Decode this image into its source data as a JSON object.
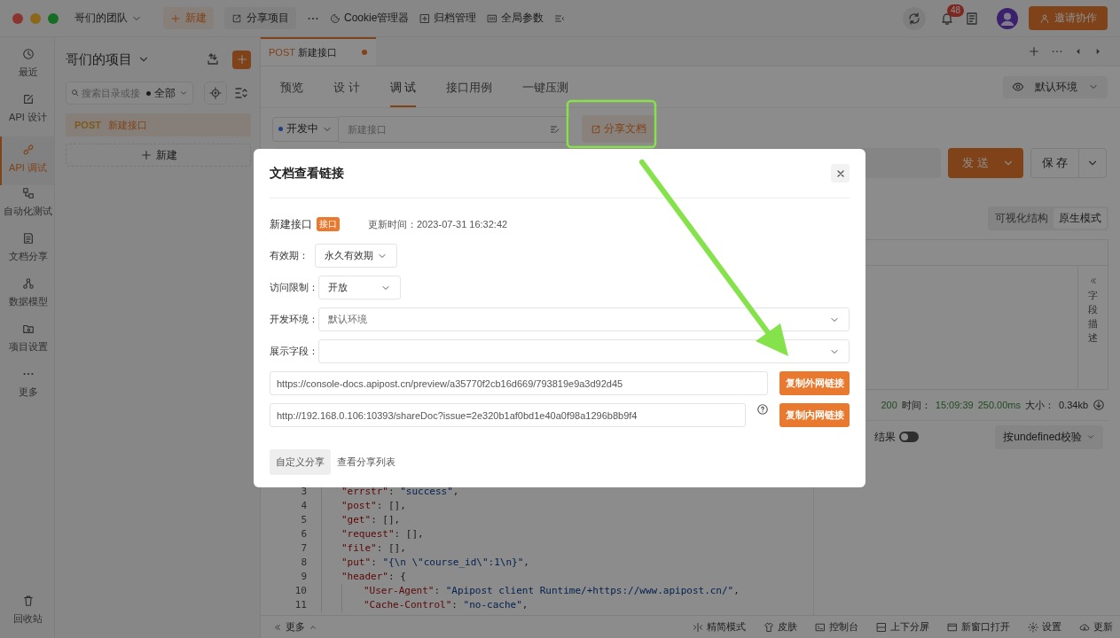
{
  "topbar": {
    "team": "哥们的团队",
    "new_button": "新建",
    "share_project": "分享项目",
    "cookie": "Cookie管理器",
    "archive": "归档管理",
    "globals": "全局参数",
    "notification_count": "48",
    "invite": "邀请协作"
  },
  "nav": [
    {
      "label": "最近",
      "selected": false
    },
    {
      "label": "API 设计",
      "selected": false
    },
    {
      "label": "API 调试",
      "selected": true
    },
    {
      "label": "自动化测试",
      "selected": false
    },
    {
      "label": "文档分享",
      "selected": false
    },
    {
      "label": "数据模型",
      "selected": false
    },
    {
      "label": "项目设置",
      "selected": false
    },
    {
      "label": "更多",
      "selected": false
    }
  ],
  "recycle_bin": "回收站",
  "project": {
    "title": "哥们的项目",
    "search_placeholder": "搜索目录或接",
    "filter": "全部",
    "items": [
      {
        "method": "POST",
        "name": "新建接口",
        "selected": true
      }
    ],
    "new_button": "新建"
  },
  "tabs": [
    {
      "method": "POST",
      "name": "新建接口",
      "unsaved": true,
      "selected": true
    }
  ],
  "subtabs": [
    {
      "label": "预览",
      "selected": false
    },
    {
      "label": "设 计",
      "selected": false
    },
    {
      "label": "调 试",
      "selected": true
    },
    {
      "label": "接口用例",
      "selected": false
    },
    {
      "label": "一键压测",
      "selected": false
    }
  ],
  "environment": "默认环境",
  "request": {
    "status": "开发中",
    "name_placeholder": "新建接口",
    "share_button": "分享文档",
    "send": "发 送",
    "save": "保 存"
  },
  "response": {
    "view_modes": [
      {
        "label": "可视化结构",
        "selected": false
      },
      {
        "label": "原生模式",
        "selected": true
      }
    ],
    "field_panel": "字段描述",
    "status": "200",
    "time_label": "时间：",
    "time": "15:09:39",
    "duration": "250.00ms",
    "size_label": "大小：",
    "size": "0.34kb",
    "result_label": "结果",
    "result_on": false,
    "validation": "按undefined校验",
    "code_lines": [
      {
        "number": "3",
        "text": "\"errstr\": \"success\","
      },
      {
        "number": "4",
        "text": "\"post\": [],"
      },
      {
        "number": "5",
        "text": "\"get\": [],"
      },
      {
        "number": "6",
        "text": "\"request\": [],"
      },
      {
        "number": "7",
        "text": "\"file\": [],"
      },
      {
        "number": "8",
        "text": "\"put\": \"{\\n \\\"course_id\\\":1\\n}\","
      },
      {
        "number": "9",
        "text": "\"header\": {",
        "children": [
          {
            "number": "10",
            "text": "\"User-Agent\": \"Apipost client Runtime/+https://www.apipost.cn/\","
          },
          {
            "number": "11",
            "text": "\"Cache-Control\": \"no-cache\","
          }
        ]
      }
    ]
  },
  "bottom_bar": {
    "more": "更多",
    "items": [
      "精简模式",
      "皮肤",
      "控制台",
      "上下分屏",
      "新窗口打开",
      "设置",
      "更新"
    ]
  },
  "dialog": {
    "title": "文档查看链接",
    "doc_name": "新建接口",
    "doc_type": "接口",
    "updated": "更新时间：2023-07-31 16:32:42",
    "fields": [
      {
        "label": "有效期：",
        "value": "永久有效期",
        "kind": "short"
      },
      {
        "label": "访问限制：",
        "value": "开放",
        "kind": "short"
      },
      {
        "label": "开发环境：",
        "value": "默认环境",
        "kind": "wide"
      },
      {
        "label": "展示字段：",
        "kind": "wide"
      }
    ],
    "links": [
      {
        "url": "https://console-docs.apipost.cn/preview/a35770f2cb16d669/793819e9a3d92d45",
        "button": "复制外网链接",
        "help": false
      },
      {
        "url": "http://192.168.0.106:10393/shareDoc?issue=2e320b1af0bd1e40a0f98a1296b8b9f4",
        "button": "复制内网链接",
        "help": true
      }
    ],
    "custom_share": "自定义分享",
    "share_list": "查看分享列表"
  }
}
